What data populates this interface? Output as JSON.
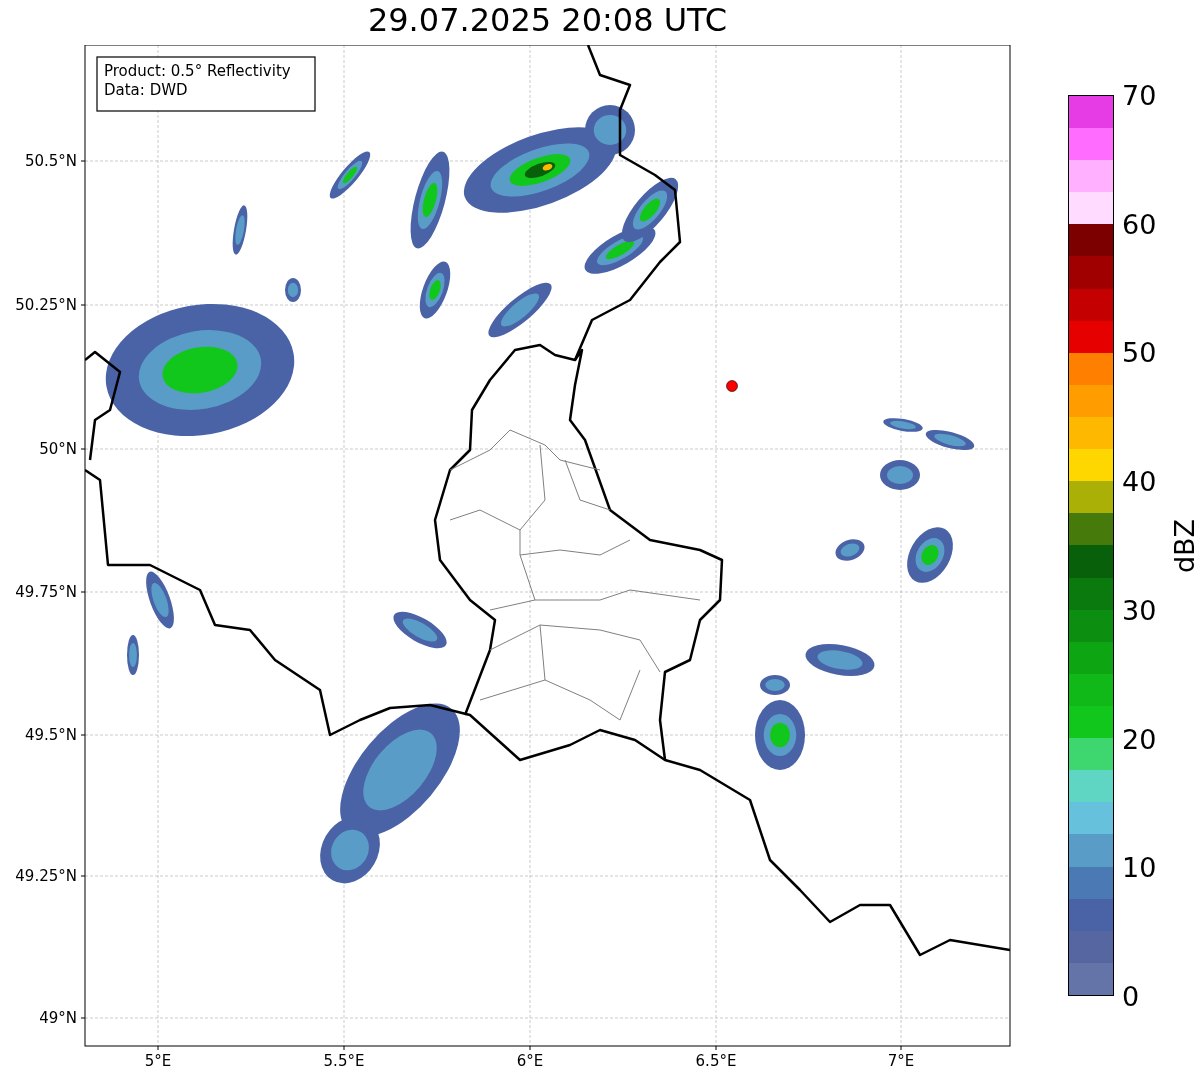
{
  "title": "29.07.2025 20:08 UTC",
  "map": {
    "xticks": [
      "5°E",
      "5.5°E",
      "6°E",
      "6.5°E",
      "7°E"
    ],
    "yticks": [
      "50.5°N",
      "50.25°N",
      "50°N",
      "49.75°N",
      "49.5°N",
      "49.25°N",
      "49°N"
    ]
  },
  "info_box": {
    "lines": [
      "Product: 0.5° Reflectivity",
      "Data: DWD"
    ]
  },
  "colorbar": {
    "label": "dBZ",
    "ticks": [
      "70",
      "60",
      "50",
      "40",
      "30",
      "20",
      "10",
      "0"
    ]
  }
}
